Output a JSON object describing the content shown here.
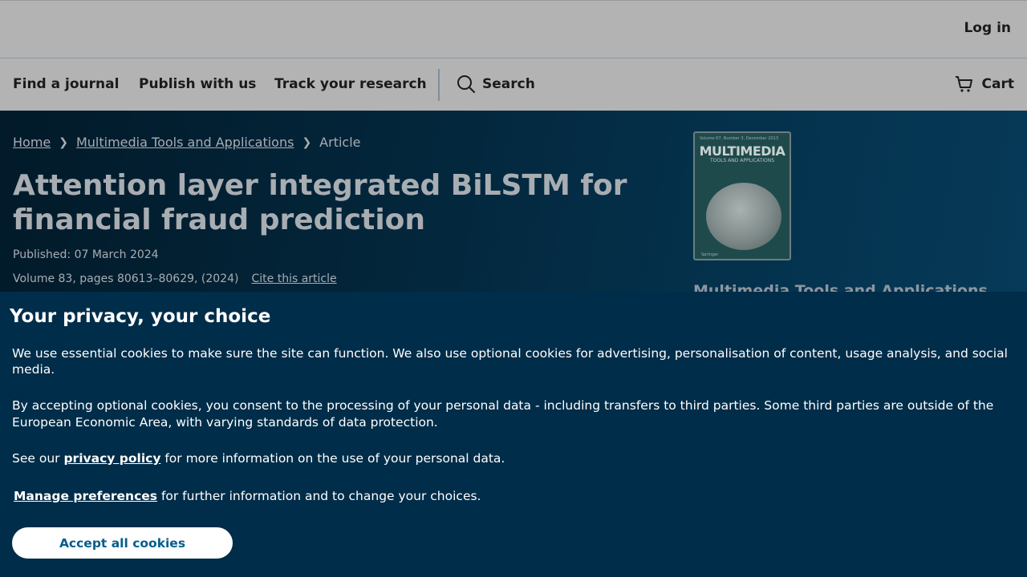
{
  "header": {
    "login_label": "Log in"
  },
  "nav": {
    "find_journal": "Find a journal",
    "publish": "Publish with us",
    "track": "Track your research",
    "search": "Search",
    "cart": "Cart"
  },
  "breadcrumb": {
    "home": "Home",
    "journal": "Multimedia Tools and Applications",
    "current": "Article"
  },
  "article": {
    "title": "Attention layer integrated BiLSTM for financial fraud prediction",
    "published": "Published: 07 March 2024",
    "volume": "Volume 83, pages 80613–80629, (2024)",
    "cite_label": "Cite this article"
  },
  "journal": {
    "name": "Multimedia Tools and Applications",
    "cover_title": "MULTIMEDIA",
    "cover_subtitle": "TOOLS AND APPLICATIONS",
    "cover_top": "Volume 67, Number 3, December 2013",
    "cover_publisher": "Springer"
  },
  "privacy": {
    "heading": "Your privacy, your choice",
    "p1": "We use essential cookies to make sure the site can function. We also use optional cookies for advertising, personalisation of content, usage analysis, and social media.",
    "p2": "By accepting optional cookies, you consent to the processing of your personal data - including transfers to third parties. Some third parties are outside of the European Economic Area, with varying standards of data protection.",
    "p3_before": "See our ",
    "p3_link": "privacy policy",
    "p3_after": " for more information on the use of your personal data.",
    "p4_link": "Manage preferences",
    "p4_after": " for further information and to change your choices.",
    "accept_label": "Accept all cookies"
  },
  "colors": {
    "banner_bg": "#002d49",
    "accept_text": "#025e8d"
  }
}
